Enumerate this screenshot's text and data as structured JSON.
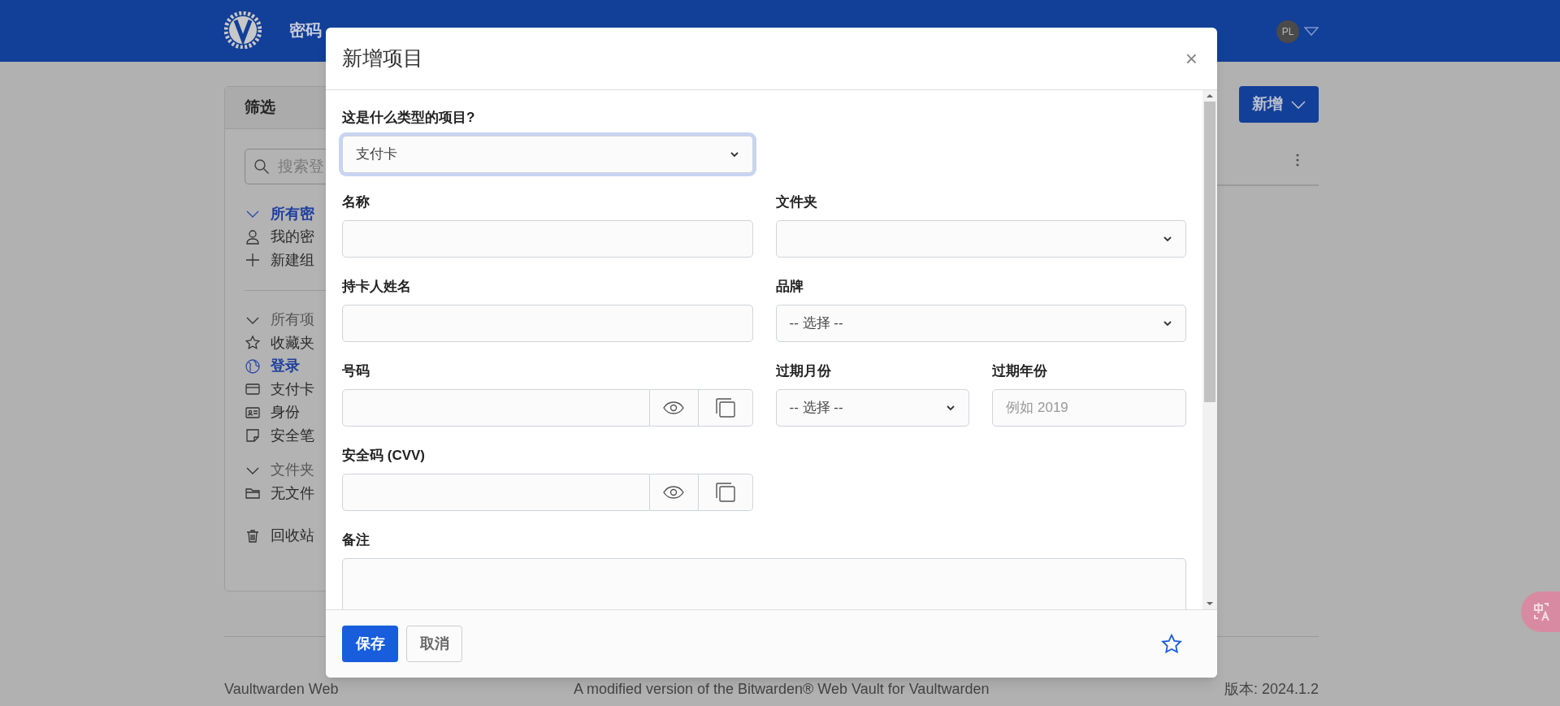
{
  "nav": {
    "items": [
      {
        "label": "密码",
        "selected": true
      }
    ],
    "avatar": "PL"
  },
  "sidebar": {
    "title": "筛选",
    "search_placeholder": "搜索登",
    "groups": [
      [
        {
          "kind": "chevron",
          "label": "所有密",
          "selected": true
        },
        {
          "kind": "person",
          "label": "我的密",
          "selected": false
        },
        {
          "kind": "plus",
          "label": "新建组",
          "selected": false
        }
      ],
      [
        {
          "kind": "chevron",
          "label": "所有项",
          "selected": false,
          "heading": true
        },
        {
          "kind": "star",
          "label": "收藏夹",
          "selected": false,
          "heading": false
        },
        {
          "kind": "globe",
          "label": "登录",
          "selected": true
        },
        {
          "kind": "card",
          "label": "支付卡",
          "selected": false
        },
        {
          "kind": "id",
          "label": "身份",
          "selected": false
        },
        {
          "kind": "note",
          "label": "安全笔",
          "selected": false
        }
      ],
      [
        {
          "kind": "chevron",
          "label": "文件夹",
          "selected": false,
          "heading": true
        },
        {
          "kind": "folder",
          "label": "无文件",
          "selected": false
        }
      ],
      [
        {
          "kind": "trash",
          "label": "回收站",
          "selected": false
        }
      ]
    ]
  },
  "new_button": "新增",
  "modal": {
    "title": "新增项目",
    "close": "×",
    "rows": [
      [
        {
          "kind": "select",
          "label": "这是什么类型的项目?",
          "value": "支付卡",
          "focused": true
        }
      ],
      [
        {
          "kind": "text",
          "label": "名称"
        },
        {
          "kind": "select",
          "label": "文件夹",
          "focused": false
        }
      ],
      [
        {
          "kind": "text",
          "label": "持卡人姓名"
        },
        {
          "kind": "select",
          "label": "品牌",
          "value": "-- 选择 --",
          "focused": false
        }
      ],
      [
        {
          "kind": "secret",
          "label": "号码"
        },
        {
          "kind": "select",
          "label": "过期月份",
          "value": "-- 选择 --",
          "focused": false
        },
        {
          "kind": "text",
          "label": "过期年份",
          "placeholder": "例如 2019"
        }
      ],
      [
        {
          "kind": "secret",
          "label": "安全码 (CVV)"
        }
      ],
      [
        {
          "kind": "textarea",
          "label": "备注"
        }
      ]
    ],
    "save": "保存",
    "cancel": "取消",
    "favorite": false
  },
  "footer": {
    "left": "Vaultwarden Web",
    "center": "A modified version of the Bitwarden® Web Vault for Vaultwarden",
    "right": "版本: 2024.1.2"
  }
}
